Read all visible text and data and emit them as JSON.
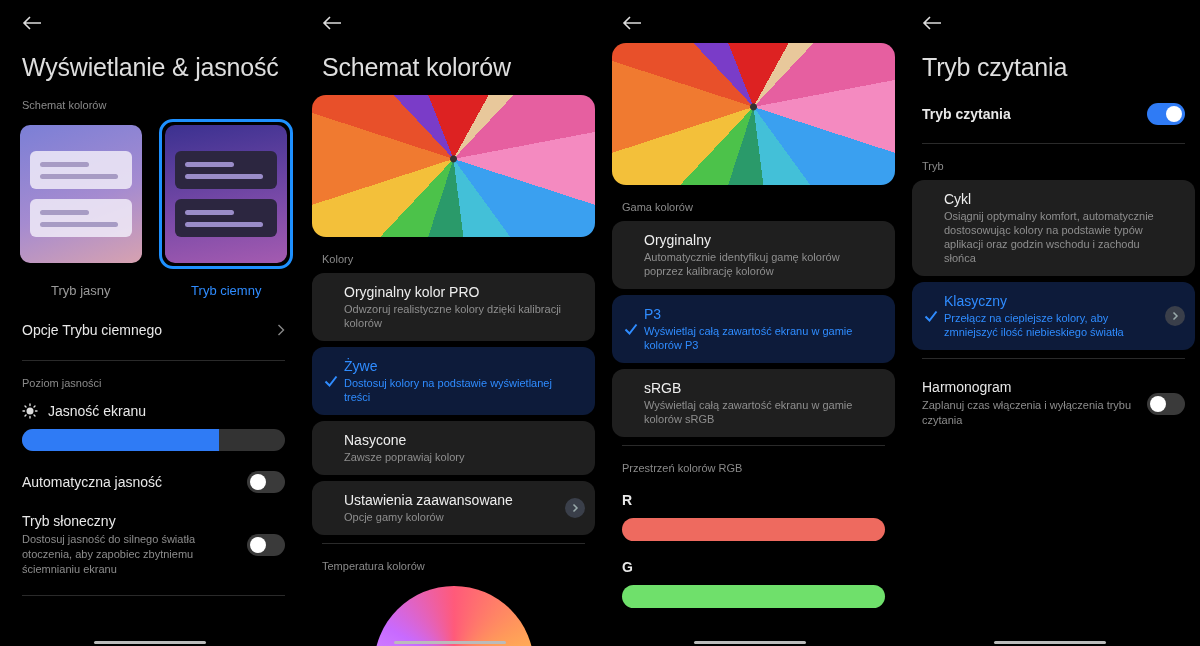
{
  "screens": [
    {
      "title": "Wyświetlanie & jasność",
      "blocks": [
        {
          "kind": "label",
          "text": "Schemat kolorów"
        },
        {
          "kind": "schemes",
          "options": [
            {
              "label": "Tryb jasny",
              "kind": "light",
              "selected": false
            },
            {
              "label": "Tryb ciemny",
              "kind": "dark",
              "selected": true
            }
          ]
        },
        {
          "kind": "nav",
          "text": "Opcje Trybu ciemnego"
        },
        {
          "kind": "divider"
        },
        {
          "kind": "label",
          "text": "Poziom jasności"
        },
        {
          "kind": "slider",
          "text": "Jasność ekranu",
          "level": 0.75
        },
        {
          "kind": "toggle",
          "text": "Automatyczna jasność",
          "on": false
        },
        {
          "kind": "toggle",
          "text": "Tryb słoneczny",
          "description": "Dostosuj jasność do silnego światła otoczenia, aby zapobiec zbytniemu ściemnianiu ekranu",
          "on": false
        },
        {
          "kind": "divider"
        }
      ]
    },
    {
      "title": "Schemat kolorów",
      "blocks": [
        {
          "kind": "photo"
        },
        {
          "kind": "label",
          "text": "Kolory"
        },
        {
          "kind": "options",
          "options": [
            {
              "title": "Oryginalny kolor PRO",
              "description": "Odwzoruj realistyczne kolory dzięki kalibracji kolorów",
              "selected": false,
              "chevron": false
            },
            {
              "title": "Żywe",
              "description": "Dostosuj kolory na podstawie wyświetlanej treści",
              "selected": true,
              "chevron": false
            },
            {
              "title": "Nasycone",
              "description": "Zawsze poprawiaj kolory",
              "selected": false,
              "chevron": false
            },
            {
              "title": "Ustawienia zaawansowane",
              "description": "Opcje gamy kolorów",
              "selected": false,
              "chevron": true
            }
          ]
        },
        {
          "kind": "divider"
        },
        {
          "kind": "label",
          "text": "Temperatura kolorów"
        },
        {
          "kind": "wheel"
        }
      ]
    },
    {
      "blocks": [
        {
          "kind": "photo"
        },
        {
          "kind": "label",
          "text": "Gama kolorów"
        },
        {
          "kind": "options",
          "options": [
            {
              "title": "Oryginalny",
              "description": "Automatycznie identyfikuj gamę kolorów poprzez kalibrację kolorów",
              "selected": false,
              "chevron": false
            },
            {
              "title": "P3",
              "description": "Wyświetlaj całą zawartość ekranu w gamie kolorów P3",
              "selected": true,
              "chevron": false
            },
            {
              "title": "sRGB",
              "description": "Wyświetlaj całą zawartość ekranu w gamie kolorów sRGB",
              "selected": false,
              "chevron": false
            }
          ]
        },
        {
          "kind": "divider"
        },
        {
          "kind": "label",
          "text": "Przestrzeń kolorów RGB"
        },
        {
          "kind": "channels",
          "channels": [
            {
              "name": "R",
              "color": "#ee6a5f"
            },
            {
              "name": "G",
              "color": "#6fe06b"
            }
          ]
        }
      ]
    },
    {
      "title": "Tryb czytania",
      "blocks": [
        {
          "kind": "toggle",
          "text": "Tryb czytania",
          "on": true,
          "strong": true
        },
        {
          "kind": "divider"
        },
        {
          "kind": "label",
          "text": "Tryb"
        },
        {
          "kind": "options",
          "options": [
            {
              "title": "Cykl",
              "description": "Osiągnij optymalny komfort, automatycznie dostosowując kolory na podstawie typów aplikacji oraz godzin wschodu i zachodu słońca",
              "selected": false,
              "chevron": false
            },
            {
              "title": "Klasyczny",
              "description": "Przełącz na cieplejsze kolory, aby zmniejszyć ilość niebieskiego światła",
              "selected": true,
              "chevron": true
            }
          ]
        },
        {
          "kind": "divider"
        },
        {
          "kind": "toggle",
          "text": "Harmonogram",
          "description": "Zaplanuj czas włączenia i wyłączenia trybu czytania",
          "on": false
        }
      ]
    }
  ]
}
